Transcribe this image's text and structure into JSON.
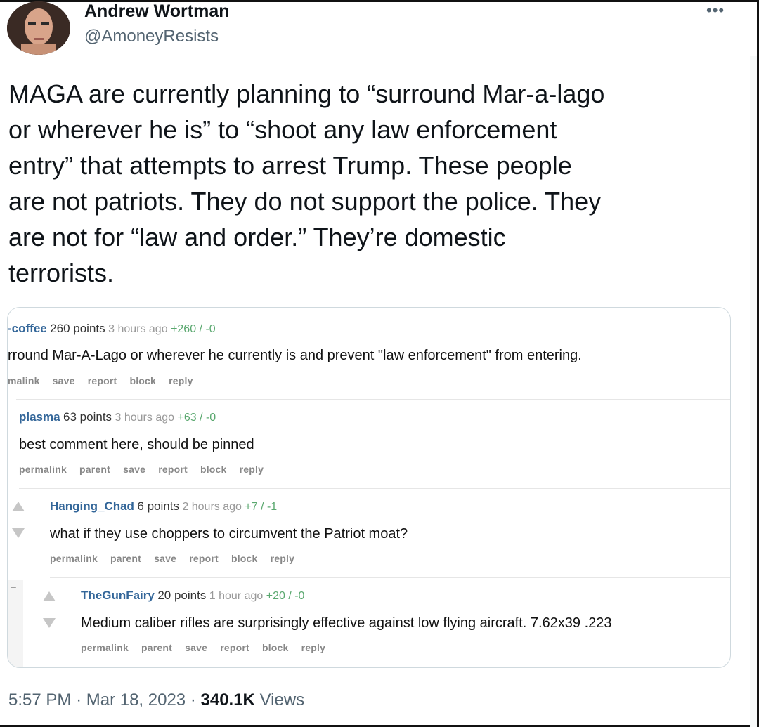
{
  "tweet": {
    "author_name": "Andrew Wortman",
    "author_handle": "@AmoneyResists",
    "more_icon": "more-horizontal-icon",
    "text_lines": [
      "MAGA are currently planning to “surround Mar-a-lago",
      "or wherever he is” to “shoot any law enforcement",
      "entry” that attempts to arrest Trump. These people",
      "are not patriots. They do not support the police. They",
      "are not for “law and order.” They’re domestic",
      "terrorists."
    ],
    "time": "5:57 PM",
    "separator": "·",
    "date": "Mar 18, 2023",
    "views_count": "340.1K",
    "views_label": "Views"
  },
  "embedded_comments": [
    {
      "username": "-coffee",
      "points": "260 points",
      "time": "3 hours ago",
      "votes": "+260 / -0",
      "text": "rround Mar-A-Lago or wherever he currently is and prevent \"law enforcement\" from entering.",
      "actions": [
        "malink",
        "save",
        "report",
        "block",
        "reply"
      ]
    },
    {
      "username": "plasma",
      "points": "63 points",
      "time": "3 hours ago",
      "votes": "+63 / -0",
      "text": "best comment here, should be pinned",
      "actions": [
        "permalink",
        "parent",
        "save",
        "report",
        "block",
        "reply"
      ]
    },
    {
      "username": "Hanging_Chad",
      "points": "6 points",
      "time": "2 hours ago",
      "votes": "+7 / -1",
      "text": "what if they use choppers to circumvent the Patriot moat?",
      "actions": [
        "permalink",
        "parent",
        "save",
        "report",
        "block",
        "reply"
      ]
    },
    {
      "username": "TheGunFairy",
      "points": "20 points",
      "time": "1 hour ago",
      "votes": "+20 / -0",
      "text": "Medium caliber rifles are surprisingly effective against low flying aircraft. 7.62x39 .223",
      "actions": [
        "permalink",
        "parent",
        "save",
        "report",
        "block",
        "reply"
      ]
    }
  ],
  "collapse_marker": "–"
}
